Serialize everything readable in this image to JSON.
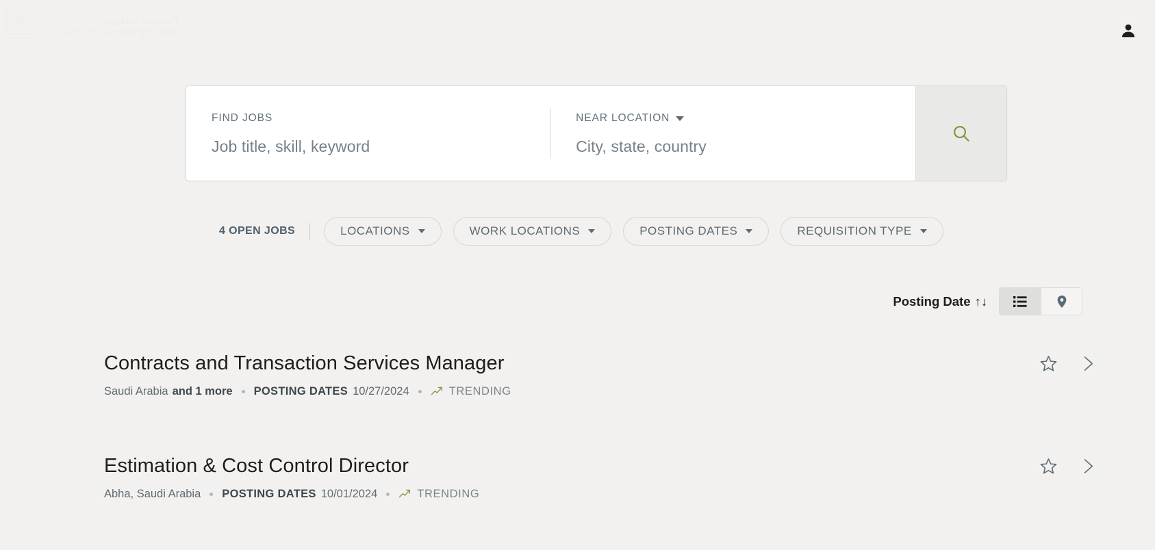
{
  "header": {
    "logo": {
      "arabic": "الســودة للتطويـر",
      "english": "Soudah Development",
      "icon": "soudah-logo-mark"
    },
    "account_icon": "user-account-icon"
  },
  "search": {
    "jobs": {
      "label": "FIND JOBS",
      "placeholder": "Job title, skill, keyword",
      "value": ""
    },
    "location": {
      "label": "NEAR LOCATION",
      "placeholder": "City, state, country",
      "value": ""
    },
    "submit_icon": "search-icon",
    "submit_icon_color": "#7d9141"
  },
  "filters": {
    "open_jobs": "4 OPEN JOBS",
    "pills": [
      {
        "label": "LOCATIONS",
        "name": "locations"
      },
      {
        "label": "WORK LOCATIONS",
        "name": "work-locations"
      },
      {
        "label": "POSTING DATES",
        "name": "posting-dates"
      },
      {
        "label": "REQUISITION TYPE",
        "name": "requisition-type"
      }
    ]
  },
  "sort": {
    "label": "Posting Date",
    "arrows": "↑↓",
    "views": [
      {
        "name": "list-view",
        "icon": "list-icon",
        "active": true
      },
      {
        "name": "map-view",
        "icon": "map-pin-icon",
        "active": false
      }
    ]
  },
  "jobs": [
    {
      "title": "Contracts and Transaction Services Manager",
      "location": "Saudi Arabia",
      "location_more": "and 1 more",
      "date_label": "POSTING DATES",
      "date_value": "10/27/2024",
      "badge": "TRENDING",
      "save_icon": "star-icon",
      "open_icon": "chevron-right-icon"
    },
    {
      "title": "Estimation & Cost Control Director",
      "location": "Abha, Saudi Arabia",
      "location_more": "",
      "date_label": "POSTING DATES",
      "date_value": "10/01/2024",
      "badge": "TRENDING",
      "save_icon": "star-icon",
      "open_icon": "chevron-right-icon"
    }
  ],
  "colors": {
    "page_background": "#f2f1ef",
    "accent_green": "#7d9141",
    "text_dark": "#1d1d1b",
    "text_muted": "#616b70"
  }
}
